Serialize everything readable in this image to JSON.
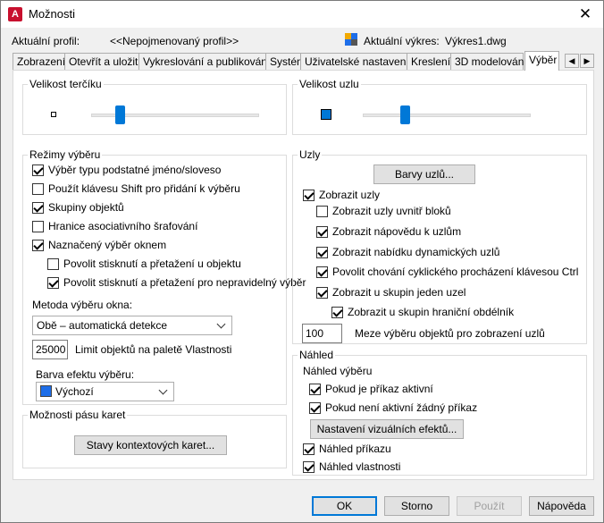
{
  "window": {
    "title": "Možnosti",
    "app_icon_letter": "A",
    "close_glyph": "✕"
  },
  "header": {
    "profile_label": "Aktuální profil:",
    "profile_value": "<<Nepojmenovaný profil>>",
    "drawing_label": "Aktuální výkres:",
    "drawing_value": "Výkres1.dwg"
  },
  "tabs": [
    "Zobrazení",
    "Otevřít a uložit",
    "Vykreslování a publikování",
    "Systém",
    "Uživatelské nastavení",
    "Kreslení",
    "3D modelování",
    "Výběr"
  ],
  "active_tab": "Výběr",
  "tab_scroll": {
    "left_glyph": "◀",
    "right_glyph": "▶"
  },
  "pickbox": {
    "title": "Velikost terčíku",
    "value_fraction": 0.17
  },
  "grip_size": {
    "title": "Velikost uzlu",
    "value_fraction": 0.25
  },
  "selection_modes": {
    "title": "Režimy výběru",
    "items": [
      {
        "label": "Výběr typu podstatné jméno/sloveso",
        "checked": true
      },
      {
        "label": "Použít klávesu Shift pro přidání k výběru",
        "checked": false
      },
      {
        "label": "Skupiny objektů",
        "checked": true
      },
      {
        "label": "Hranice asociativního šrafování",
        "checked": false
      },
      {
        "label": "Naznačený výběr oknem",
        "checked": true
      },
      {
        "label": "Povolit stisknutí a přetažení u objektu",
        "checked": false
      },
      {
        "label": "Povolit stisknutí a přetažení pro nepravidelný výběr",
        "checked": true
      }
    ],
    "window_method_label": "Metoda výběru okna:",
    "window_method_value": "Obě – automatická detekce",
    "limit_value": "25000",
    "limit_label": "Limit objektů na paletě Vlastnosti",
    "effect_color_label": "Barva efektu výběru:",
    "effect_color_value": "Výchozí",
    "effect_color_swatch": "#1e6ee8"
  },
  "ribbon": {
    "title": "Možnosti pásu karet",
    "button": "Stavy kontextových karet..."
  },
  "grips": {
    "title": "Uzly",
    "colors_button": "Barvy uzlů...",
    "items": [
      {
        "label": "Zobrazit uzly",
        "checked": true
      },
      {
        "label": "Zobrazit uzly uvnitř bloků",
        "checked": false
      },
      {
        "label": "Zobrazit nápovědu k uzlům",
        "checked": true
      },
      {
        "label": "Zobrazit nabídku dynamických uzlů",
        "checked": true
      },
      {
        "label": "Povolit chování cyklického procházení klávesou Ctrl",
        "checked": true
      },
      {
        "label": "Zobrazit u skupin jeden uzel",
        "checked": true
      },
      {
        "label": "Zobrazit u skupin hraniční obdélník",
        "checked": true
      }
    ],
    "limit_value": "100",
    "limit_label": "Meze výběru objektů pro zobrazení uzlů"
  },
  "preview": {
    "title": "Náhled",
    "subtitle": "Náhled výběru",
    "items": [
      {
        "label": "Pokud je příkaz aktivní",
        "checked": true
      },
      {
        "label": "Pokud není aktivní žádný příkaz",
        "checked": true
      }
    ],
    "visual_effects_button": "Nastavení vizuálních efektů...",
    "bottom_items": [
      {
        "label": "Náhled příkazu",
        "checked": true
      },
      {
        "label": "Náhled vlastnosti",
        "checked": true
      }
    ]
  },
  "footer": {
    "ok": "OK",
    "cancel": "Storno",
    "apply": "Použít",
    "help": "Nápověda"
  },
  "colors": {
    "accent": "#0078d7",
    "grip_blue": "#0078d7"
  }
}
